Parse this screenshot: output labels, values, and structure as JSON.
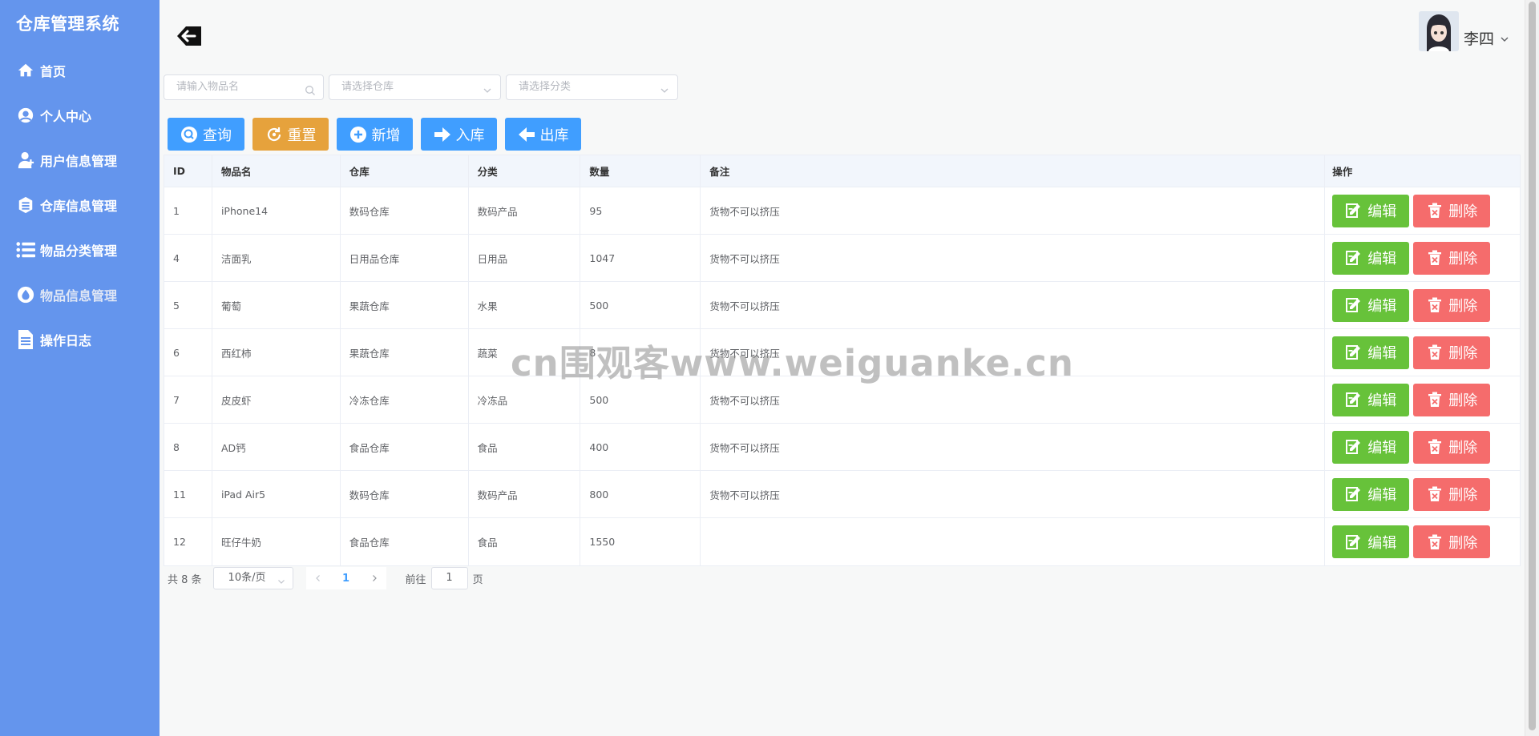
{
  "app": {
    "title": "仓库管理系统"
  },
  "sidebar": {
    "items": [
      {
        "label": "首页",
        "icon": "home-icon"
      },
      {
        "label": "个人中心",
        "icon": "user-center-icon"
      },
      {
        "label": "用户信息管理",
        "icon": "user-add-icon"
      },
      {
        "label": "仓库信息管理",
        "icon": "warehouse-icon"
      },
      {
        "label": "物品分类管理",
        "icon": "list-icon"
      },
      {
        "label": "物品信息管理",
        "icon": "drop-icon",
        "active": true
      },
      {
        "label": "操作日志",
        "icon": "document-icon"
      }
    ]
  },
  "header": {
    "user_name": "李四"
  },
  "filters": {
    "name_placeholder": "请输入物品名",
    "warehouse_placeholder": "请选择仓库",
    "category_placeholder": "请选择分类"
  },
  "actions": {
    "query": "查询",
    "reset": "重置",
    "add": "新增",
    "stock_in": "入库",
    "stock_out": "出库"
  },
  "table": {
    "columns": [
      "ID",
      "物品名",
      "仓库",
      "分类",
      "数量",
      "备注",
      "操作"
    ],
    "rows": [
      {
        "id": "1",
        "name": "iPhone14",
        "warehouse": "数码仓库",
        "category": "数码产品",
        "count": "95",
        "remark": "货物不可以挤压"
      },
      {
        "id": "4",
        "name": "洁面乳",
        "warehouse": "日用品仓库",
        "category": "日用品",
        "count": "1047",
        "remark": "货物不可以挤压"
      },
      {
        "id": "5",
        "name": "葡萄",
        "warehouse": "果蔬仓库",
        "category": "水果",
        "count": "500",
        "remark": "货物不可以挤压"
      },
      {
        "id": "6",
        "name": "西红柿",
        "warehouse": "果蔬仓库",
        "category": "蔬菜",
        "count": "8",
        "remark": "货物不可以挤压"
      },
      {
        "id": "7",
        "name": "皮皮虾",
        "warehouse": "冷冻仓库",
        "category": "冷冻品",
        "count": "500",
        "remark": "货物不可以挤压"
      },
      {
        "id": "8",
        "name": "AD钙",
        "warehouse": "食品仓库",
        "category": "食品",
        "count": "400",
        "remark": "货物不可以挤压"
      },
      {
        "id": "11",
        "name": "iPad Air5",
        "warehouse": "数码仓库",
        "category": "数码产品",
        "count": "800",
        "remark": "货物不可以挤压"
      },
      {
        "id": "12",
        "name": "旺仔牛奶",
        "warehouse": "食品仓库",
        "category": "食品",
        "count": "1550",
        "remark": ""
      }
    ],
    "edit_label": "编辑",
    "delete_label": "删除"
  },
  "pagination": {
    "total_text": "共 8 条",
    "page_size": "10条/页",
    "current_page": "1",
    "goto_prefix": "前往",
    "goto_value": "1",
    "goto_suffix": "页"
  },
  "watermark": "cn围观客www.weiguanke.cn",
  "colors": {
    "sidebar": "#6495ed",
    "primary": "#409eff",
    "warning": "#e6a23c",
    "success": "#67c23a",
    "danger": "#f56c6c"
  }
}
